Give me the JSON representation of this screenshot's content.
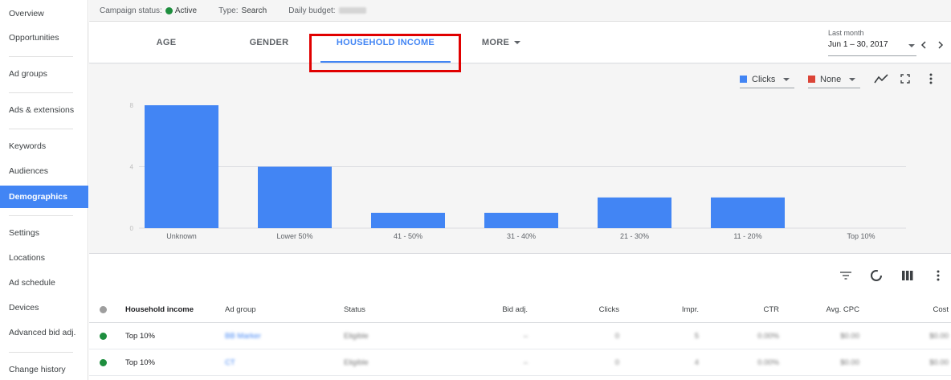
{
  "sidebar": {
    "items": [
      {
        "label": "Overview"
      },
      {
        "label": "Opportunities"
      },
      {
        "label": "Ad groups"
      },
      {
        "label": "Ads & extensions"
      },
      {
        "label": "Keywords"
      },
      {
        "label": "Audiences"
      },
      {
        "label": "Demographics",
        "active": true
      },
      {
        "label": "Settings"
      },
      {
        "label": "Locations"
      },
      {
        "label": "Ad schedule"
      },
      {
        "label": "Devices"
      },
      {
        "label": "Advanced bid adj."
      },
      {
        "label": "Change history"
      }
    ]
  },
  "status_bar": {
    "campaign_status_label": "Campaign status:",
    "campaign_status_value": "Active",
    "type_label": "Type:",
    "type_value": "Search",
    "daily_budget_label": "Daily budget:",
    "status_color": "#1e8e3e"
  },
  "tabs": [
    {
      "label": "AGE"
    },
    {
      "label": "GENDER"
    },
    {
      "label": "HOUSEHOLD INCOME",
      "active": true
    },
    {
      "label": "MORE"
    }
  ],
  "date_range": {
    "label": "Last month",
    "value": "Jun 1 – 30, 2017",
    "prev_icon": "chevron-left-icon",
    "next_icon": "chevron-right-icon"
  },
  "chart_controls": {
    "metric1": {
      "label": "Clicks",
      "color": "#4285f4"
    },
    "metric2": {
      "label": "None",
      "color": "#db4437"
    }
  },
  "chart_data": {
    "type": "bar",
    "categories": [
      "Unknown",
      "Lower 50%",
      "41 - 50%",
      "31 - 40%",
      "21 - 30%",
      "11 - 20%",
      "Top 10%"
    ],
    "values": [
      8,
      4,
      1,
      1,
      2,
      2,
      0
    ],
    "y_ticks": [
      "8",
      "4",
      "0"
    ],
    "ylim": [
      0,
      8
    ],
    "grid": true,
    "bar_color": "#4285f4"
  },
  "table": {
    "columns": [
      "Household income",
      "Ad group",
      "Status",
      "Bid adj.",
      "Clicks",
      "Impr.",
      "CTR",
      "Avg. CPC",
      "Cost"
    ],
    "rows": [
      {
        "income": "Top 10%",
        "ad_group": "BB Marker",
        "status": "Eligible",
        "bid_adj": "–",
        "clicks": "0",
        "impr": "5",
        "ctr": "0.00%",
        "avg_cpc": "$0.00",
        "cost": "$0.00",
        "dot_color": "#1e8e3e"
      },
      {
        "income": "Top 10%",
        "ad_group": "CT",
        "status": "Eligible",
        "bid_adj": "–",
        "clicks": "0",
        "impr": "4",
        "ctr": "0.00%",
        "avg_cpc": "$0.00",
        "cost": "$0.00",
        "dot_color": "#1e8e3e"
      }
    ],
    "header_dot_color": "#9e9e9e"
  },
  "icons": {
    "line_chart": "line-chart-icon",
    "expand": "expand-icon",
    "more_vert": "more-vert-icon",
    "filter": "filter-icon",
    "segment": "segment-icon",
    "columns": "columns-icon"
  }
}
